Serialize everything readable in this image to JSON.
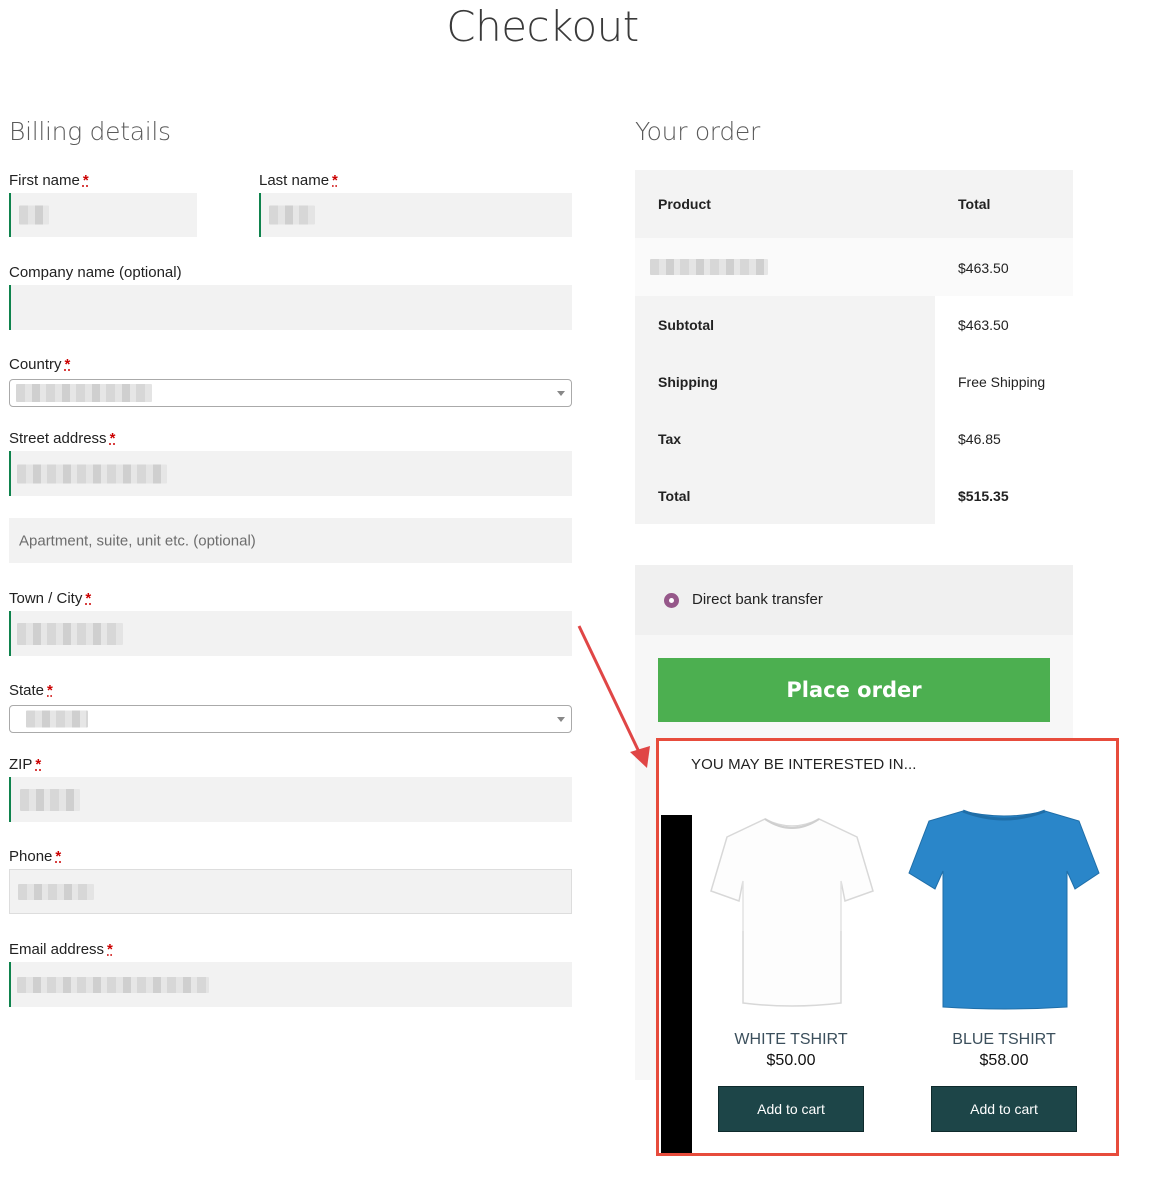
{
  "page": {
    "title": "Checkout"
  },
  "billing": {
    "heading": "Billing details",
    "first_name_label": "First name",
    "last_name_label": "Last name",
    "company_label": "Company name (optional)",
    "country_label": "Country",
    "street_label": "Street address",
    "apartment_placeholder": "Apartment, suite, unit etc. (optional)",
    "city_label": "Town / City",
    "state_label": "State",
    "zip_label": "ZIP",
    "phone_label": "Phone",
    "email_label": "Email address",
    "required_mark": "*"
  },
  "order": {
    "heading": "Your order",
    "col_product": "Product",
    "col_total": "Total",
    "item_total": "$463.50",
    "subtotal_label": "Subtotal",
    "subtotal_value": "$463.50",
    "shipping_label": "Shipping",
    "shipping_value": "Free Shipping",
    "tax_label": "Tax",
    "tax_value": "$46.85",
    "total_label": "Total",
    "total_value": "$515.35"
  },
  "payment": {
    "method": "Direct bank transfer",
    "place_order_label": "Place order"
  },
  "upsell": {
    "title": "YOU MAY BE INTERESTED IN...",
    "products": [
      {
        "name": "WHITE TSHIRT",
        "price": "$50.00",
        "button": "Add to cart",
        "color": "#ffffff"
      },
      {
        "name": "BLUE TSHIRT",
        "price": "$58.00",
        "button": "Add to cart",
        "color": "#2a86c9"
      }
    ]
  },
  "colors": {
    "accent_green": "#0f834d",
    "place_order": "#4caf50",
    "highlight_red": "#e74c3c",
    "radio_purple": "#96588a",
    "cart_button": "#1d4548"
  }
}
